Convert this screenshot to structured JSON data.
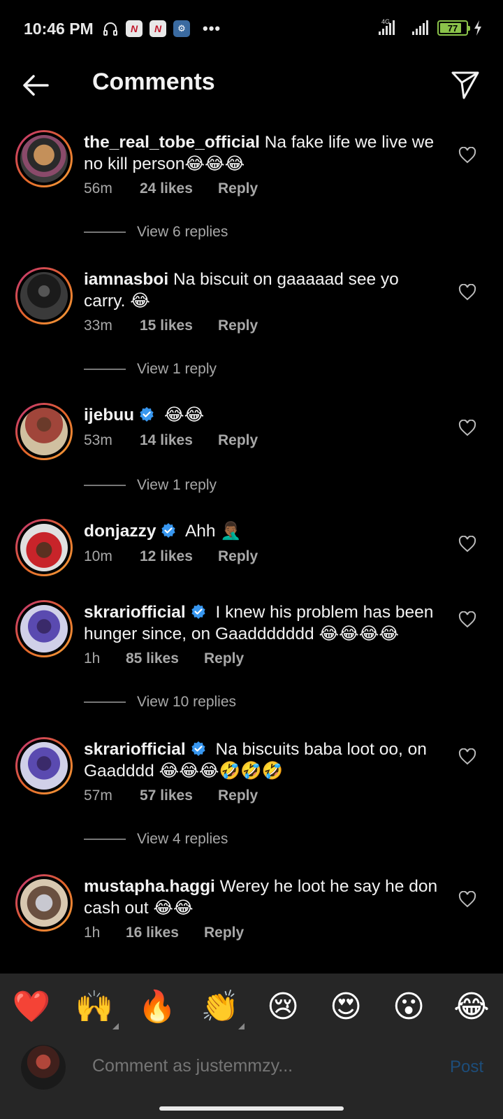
{
  "status_bar": {
    "time": "10:46 PM",
    "network": "4G",
    "battery": "77"
  },
  "header": {
    "title": "Comments"
  },
  "comments": [
    {
      "username": "the_real_tobe_official",
      "verified": false,
      "text": "Na fake life we live we no kill person😂😂😂",
      "time": "56m",
      "likes": "24 likes",
      "reply": "Reply",
      "view_replies": "View 6 replies"
    },
    {
      "username": "iamnasboi",
      "verified": false,
      "text": "Na biscuit on gaaaaad see yo carry. 😂",
      "time": "33m",
      "likes": "15 likes",
      "reply": "Reply",
      "view_replies": "View 1 reply"
    },
    {
      "username": "ijebuu",
      "verified": true,
      "text": "😂😂",
      "time": "53m",
      "likes": "14 likes",
      "reply": "Reply",
      "view_replies": "View 1 reply"
    },
    {
      "username": "donjazzy",
      "verified": true,
      "text": "Ahh 🤦🏾‍♂️",
      "time": "10m",
      "likes": "12 likes",
      "reply": "Reply",
      "view_replies": ""
    },
    {
      "username": "skrariofficial",
      "verified": true,
      "text": "I knew his problem has been hunger since, on Gaaddddddd 😂😂😂😂",
      "time": "1h",
      "likes": "85 likes",
      "reply": "Reply",
      "view_replies": "View 10 replies"
    },
    {
      "username": "skrariofficial",
      "verified": true,
      "text": "Na biscuits baba loot oo, on Gaadddd 😂😂😂🤣🤣🤣",
      "time": "57m",
      "likes": "57 likes",
      "reply": "Reply",
      "view_replies": "View 4 replies"
    },
    {
      "username": "mustapha.haggi",
      "verified": false,
      "text": "Werey he loot he say he don cash out 😂😂",
      "time": "1h",
      "likes": "16 likes",
      "reply": "Reply",
      "view_replies": ""
    }
  ],
  "quick_emojis": [
    "❤️",
    "🙌",
    "🔥",
    "👏",
    "😢",
    "😍",
    "😮",
    "😂"
  ],
  "composer": {
    "placeholder": "Comment as justemmzy...",
    "post_label": "Post"
  },
  "icons": {
    "back": "arrow-left-icon",
    "send": "paper-plane-icon",
    "like": "heart-outline-icon",
    "verified": "verified-badge-icon"
  },
  "colors": {
    "background": "#000000",
    "bar_background": "#262626",
    "verified_blue": "#3897f0",
    "post_disabled": "#1d4d7a",
    "avatar_ring_start": "#c0317a",
    "avatar_ring_end": "#f4a03a"
  }
}
